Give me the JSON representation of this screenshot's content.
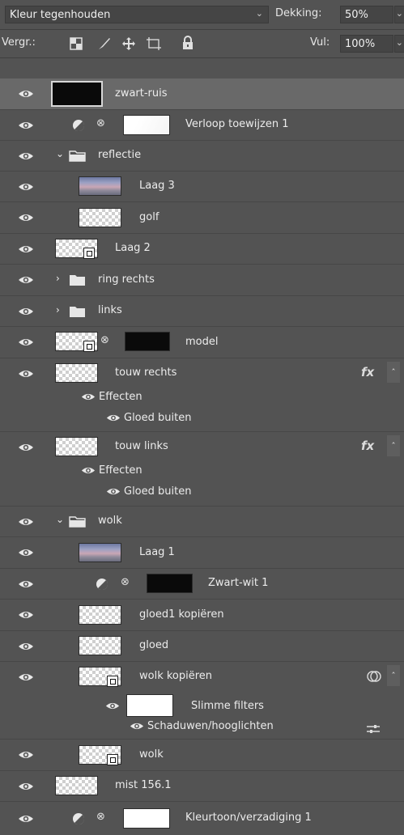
{
  "header": {
    "blend_mode": "Kleur tegenhouden",
    "opacity_label": "Dekking:",
    "opacity_value": "50%",
    "lock_label": "Vergr.:",
    "fill_label": "Vul:",
    "fill_value": "100%"
  },
  "layers": {
    "zwart_ruis": "zwart-ruis",
    "verloop": "Verloop toewijzen 1",
    "reflectie": "reflectie",
    "laag3": "Laag 3",
    "golf": "golf",
    "laag2": "Laag 2",
    "ring_rechts": "ring rechts",
    "links": "links",
    "model": "model",
    "touw_rechts": "touw rechts",
    "touw_links": "touw links",
    "effecten": "Effecten",
    "gloed_buiten": "Gloed buiten",
    "wolk_group": "wolk",
    "laag1": "Laag 1",
    "zwart_wit": "Zwart-wit 1",
    "gloed1_kopieren": "gloed1 kopiëren",
    "gloed": "gloed",
    "wolk_kopieren": "wolk kopiëren",
    "slimme_filters": "Slimme filters",
    "schaduwen": "Schaduwen/hooglichten",
    "wolk": "wolk",
    "mist": "mist 156.1",
    "kleurtoon": "Kleurtoon/verzadiging 1"
  },
  "fx_label": "fx"
}
